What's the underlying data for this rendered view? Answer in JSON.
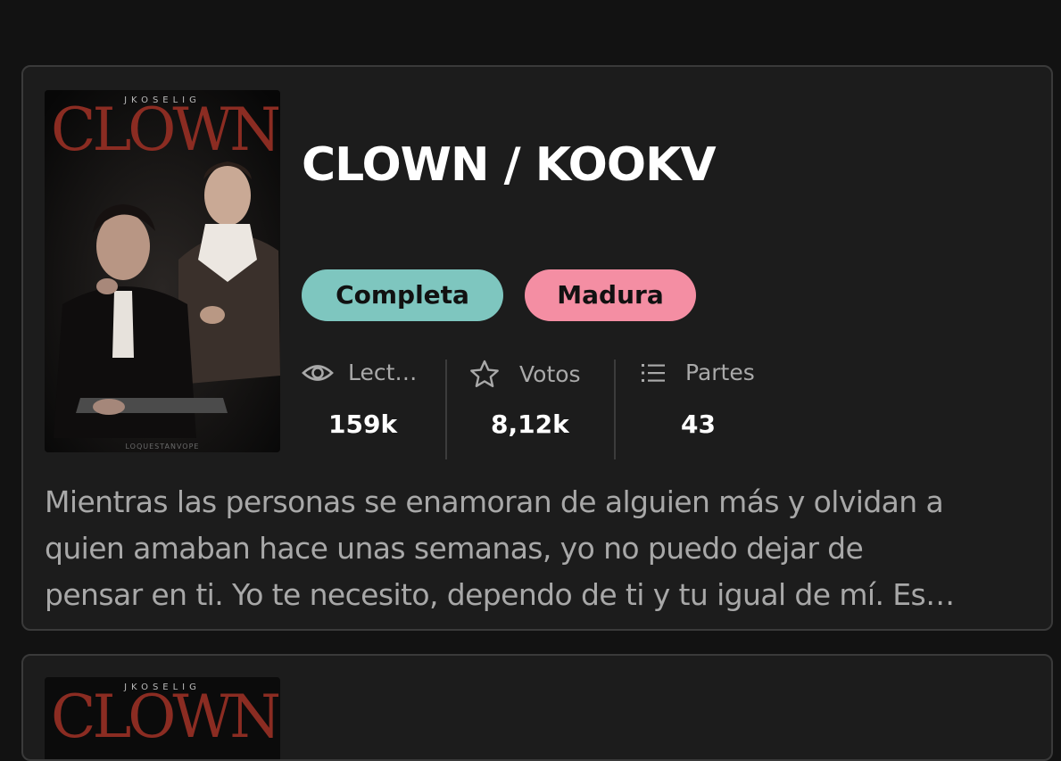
{
  "story": {
    "cover_author": "JKOSELIG",
    "cover_title": "CLOWN",
    "cover_footer": "LOQUESTANVOPE",
    "title": "CLOWN / KOOKV",
    "tags": {
      "complete": "Completa",
      "mature": "Madura"
    },
    "colors": {
      "complete_tag": "#7ec6bf",
      "mature_tag": "#f48ea3"
    },
    "stats": {
      "reads": {
        "icon": "eye-icon",
        "label": "Lect…",
        "value": "159k"
      },
      "votes": {
        "icon": "star-icon",
        "label": "Votos",
        "value": "8,12k"
      },
      "parts": {
        "icon": "list-icon",
        "label": "Partes",
        "value": "43"
      }
    },
    "description_lines": [
      "Mientras las personas se enamoran de alguien más y olvidan a",
      "quien amaban hace unas semanas, yo no puedo dejar de",
      "pensar en ti. Yo te necesito, dependo de ti y tu igual de mí. Es…"
    ]
  },
  "next_story": {
    "cover_author": "JKOSELIG",
    "cover_title": "CLOWN"
  }
}
